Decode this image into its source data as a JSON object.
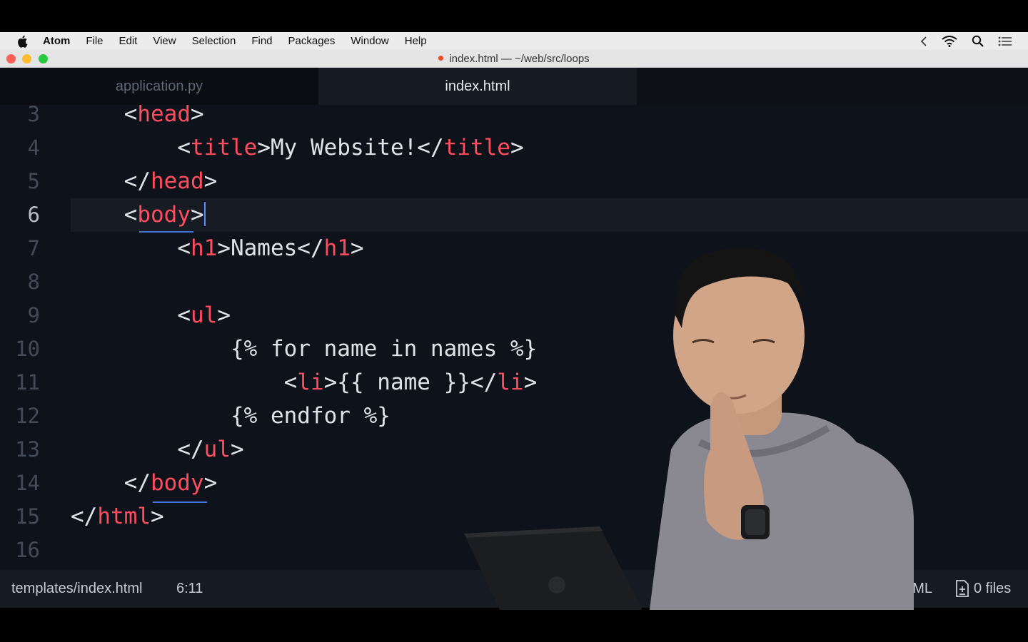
{
  "menubar": {
    "items": [
      "Atom",
      "File",
      "Edit",
      "View",
      "Selection",
      "Find",
      "Packages",
      "Window",
      "Help"
    ]
  },
  "window": {
    "title": "index.html — ~/web/src/loops"
  },
  "tabs": [
    {
      "label": "application.py",
      "active": false
    },
    {
      "label": "index.html",
      "active": true
    }
  ],
  "editor": {
    "current_line": 6,
    "lines": [
      {
        "n": "3",
        "segments": [
          [
            "    ",
            "p"
          ],
          [
            "<",
            "p"
          ],
          [
            "head",
            "t"
          ],
          [
            ">",
            "p"
          ]
        ]
      },
      {
        "n": "4",
        "segments": [
          [
            "        ",
            "p"
          ],
          [
            "<",
            "p"
          ],
          [
            "title",
            "t"
          ],
          [
            ">My Website!</",
            "p"
          ],
          [
            "title",
            "t"
          ],
          [
            ">",
            "p"
          ]
        ]
      },
      {
        "n": "5",
        "segments": [
          [
            "    ",
            "p"
          ],
          [
            "</",
            "p"
          ],
          [
            "head",
            "t"
          ],
          [
            ">",
            "p"
          ]
        ]
      },
      {
        "n": "6",
        "segments": [
          [
            "    ",
            "p"
          ],
          [
            "<",
            "p"
          ],
          [
            "body",
            "t"
          ],
          [
            ">",
            "p"
          ]
        ]
      },
      {
        "n": "7",
        "segments": [
          [
            "        ",
            "p"
          ],
          [
            "<",
            "p"
          ],
          [
            "h1",
            "t"
          ],
          [
            ">Names</",
            "p"
          ],
          [
            "h1",
            "t"
          ],
          [
            ">",
            "p"
          ]
        ]
      },
      {
        "n": "8",
        "segments": []
      },
      {
        "n": "9",
        "segments": [
          [
            "        ",
            "p"
          ],
          [
            "<",
            "p"
          ],
          [
            "ul",
            "t"
          ],
          [
            ">",
            "p"
          ]
        ]
      },
      {
        "n": "10",
        "segments": [
          [
            "            ",
            "p"
          ],
          [
            "{% for name in names %}",
            "p"
          ]
        ]
      },
      {
        "n": "11",
        "segments": [
          [
            "                ",
            "p"
          ],
          [
            "<",
            "p"
          ],
          [
            "li",
            "t"
          ],
          [
            ">{{ name }}</",
            "p"
          ],
          [
            "li",
            "t"
          ],
          [
            ">",
            "p"
          ]
        ]
      },
      {
        "n": "12",
        "segments": [
          [
            "            ",
            "p"
          ],
          [
            "{% endfor %}",
            "p"
          ]
        ]
      },
      {
        "n": "13",
        "segments": [
          [
            "        ",
            "p"
          ],
          [
            "</",
            "p"
          ],
          [
            "ul",
            "t"
          ],
          [
            ">",
            "p"
          ]
        ]
      },
      {
        "n": "14",
        "segments": [
          [
            "    ",
            "p"
          ],
          [
            "</",
            "p"
          ],
          [
            "body",
            "t"
          ],
          [
            ">",
            "p"
          ]
        ]
      },
      {
        "n": "15",
        "segments": [
          [
            "</",
            "p"
          ],
          [
            "html",
            "t"
          ],
          [
            ">",
            "p"
          ]
        ]
      },
      {
        "n": "16",
        "segments": []
      }
    ]
  },
  "statusbar": {
    "path": "templates/index.html",
    "cursor_position": "6:11",
    "grammar_partial": "TML",
    "files": "0 files"
  },
  "colors": {
    "tag": "#ff4d5e",
    "text": "#dcdfe4",
    "background": "#0e121a",
    "cursor": "#5b8cff"
  }
}
